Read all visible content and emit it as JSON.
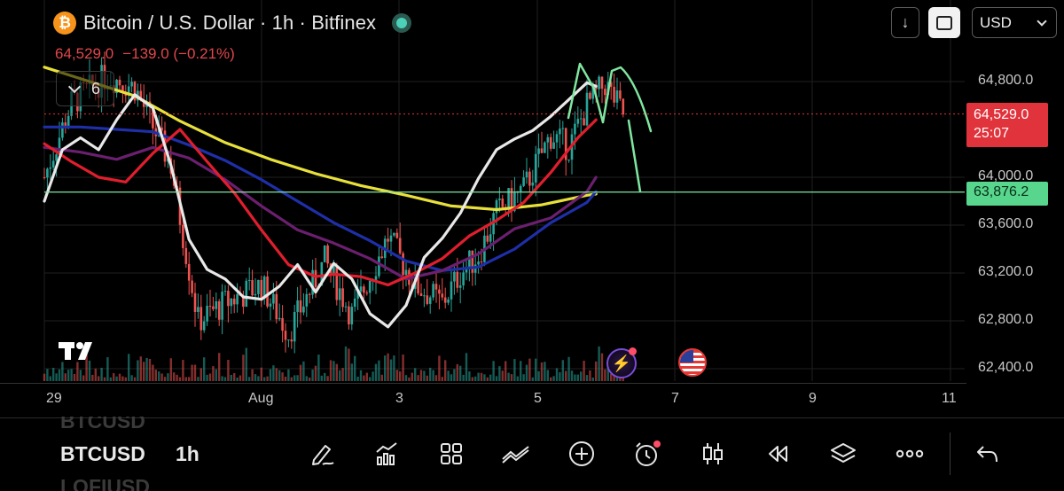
{
  "header": {
    "title": "Bitcoin / U.S. Dollar · 1h · Bitfinex",
    "logo_glyph": "₿",
    "quote_price": "64,529.0",
    "quote_change": "−139.0 (−0.21%)",
    "indicator_count": "6"
  },
  "top_controls": {
    "download_glyph": "↓",
    "currency": "USD"
  },
  "price_axis": {
    "labels": [
      "64,800.0",
      "64,000.0",
      "63,600.0",
      "63,200.0",
      "62,800.0",
      "62,400.0"
    ],
    "current_price": "64,529.0",
    "countdown": "25:07",
    "level_price": "63,876.2"
  },
  "time_axis": {
    "labels": [
      "29",
      "Aug",
      "3",
      "5",
      "7",
      "9",
      "11"
    ]
  },
  "bottom_bar": {
    "symbol": "BTCUSD",
    "interval": "1h",
    "ghost_above": "BTCUSD",
    "ghost_below": "LOFIUSD",
    "tools": [
      "pencil-icon",
      "indicators-icon",
      "apps-icon",
      "compare-icon",
      "add-icon",
      "alert-clock-icon",
      "candles-icon",
      "replay-icon",
      "layers-icon",
      "more-icon",
      "undo-icon"
    ]
  },
  "colors": {
    "background": "#000000",
    "up_candle": "#26a69a",
    "down_candle": "#ef5350",
    "ma_white": "#e8e8e8",
    "ma_red": "#e01e2d",
    "ma_yellow": "#e8e03a",
    "ma_blue": "#1e2fa8",
    "ma_purple": "#6b1f6f",
    "drawing_green": "#7fe6a0",
    "price_tag_red": "#e1333c",
    "price_tag_green": "#58d68d"
  },
  "chart_data": {
    "type": "candlestick",
    "title": "Bitcoin / U.S. Dollar · 1h · Bitfinex",
    "ylim": [
      62300,
      65050
    ],
    "y_ticks": [
      64800,
      64000,
      63600,
      63200,
      62800,
      62400
    ],
    "x_ticks": [
      "29",
      "Aug",
      "3",
      "5",
      "7",
      "9",
      "11"
    ],
    "current_price": 64529.0,
    "horizontal_level": 63876.2,
    "close_path": {
      "t": [
        0,
        3,
        7,
        10,
        14,
        17,
        20,
        24,
        27,
        31,
        34,
        38,
        41,
        44,
        46,
        48,
        50,
        53,
        56,
        58,
        60,
        62,
        64
      ],
      "price": [
        64000,
        64620,
        64850,
        64750,
        64100,
        62800,
        62950,
        63100,
        62700,
        63300,
        62850,
        63500,
        63100,
        62950,
        63200,
        63350,
        63700,
        63900,
        64350,
        64250,
        64600,
        64780,
        64529
      ]
    },
    "series": [
      {
        "name": "",
        "color": "#e8e8e8",
        "t": [
          0,
          2,
          4,
          6,
          8,
          10,
          12,
          14,
          16,
          18,
          20,
          22,
          24,
          26,
          28,
          30,
          32,
          34,
          36,
          38,
          40,
          42,
          44,
          46,
          48,
          50,
          52,
          54,
          56,
          58,
          60,
          61
        ],
        "values": [
          63800,
          64230,
          64330,
          64230,
          64480,
          64690,
          64580,
          64100,
          63480,
          63230,
          63150,
          63000,
          62980,
          63090,
          63270,
          63040,
          63280,
          63150,
          62860,
          62750,
          62930,
          63330,
          63490,
          63700,
          63990,
          64230,
          64320,
          64390,
          64510,
          64650,
          64790,
          64760
        ]
      },
      {
        "name": "",
        "color": "#e01e2d",
        "t": [
          0,
          3,
          6,
          9,
          12,
          15,
          18,
          21,
          24,
          27,
          30,
          32,
          35,
          38,
          41,
          44,
          47,
          50,
          53,
          56,
          59,
          61
        ],
        "values": [
          64280,
          64130,
          64000,
          63960,
          64200,
          64400,
          64130,
          63870,
          63560,
          63270,
          63170,
          63190,
          63170,
          63100,
          63200,
          63320,
          63510,
          63640,
          63790,
          64040,
          64330,
          64480
        ]
      },
      {
        "name": "",
        "color": "#6b1f6f",
        "t": [
          0,
          4,
          8,
          12,
          16,
          20,
          24,
          28,
          32,
          36,
          40,
          44,
          48,
          52,
          56,
          60,
          61
        ],
        "values": [
          64250,
          64210,
          64150,
          64250,
          64160,
          63980,
          63760,
          63560,
          63450,
          63320,
          63150,
          63220,
          63360,
          63570,
          63660,
          63880,
          64000
        ]
      },
      {
        "name": "",
        "color": "#1e2fa8",
        "t": [
          0,
          4,
          8,
          12,
          16,
          20,
          24,
          28,
          32,
          36,
          40,
          44,
          48,
          52,
          56,
          60,
          61
        ],
        "values": [
          64420,
          64420,
          64400,
          64380,
          64270,
          64140,
          63980,
          63800,
          63620,
          63470,
          63300,
          63220,
          63250,
          63400,
          63620,
          63790,
          63880
        ]
      },
      {
        "name": "",
        "color": "#e8e03a",
        "t": [
          0,
          5,
          10,
          15,
          20,
          25,
          30,
          35,
          40,
          45,
          50,
          55,
          60,
          61
        ],
        "values": [
          64920,
          64800,
          64680,
          64470,
          64290,
          64150,
          64030,
          63930,
          63850,
          63760,
          63730,
          63770,
          63850,
          63860
        ]
      }
    ]
  }
}
